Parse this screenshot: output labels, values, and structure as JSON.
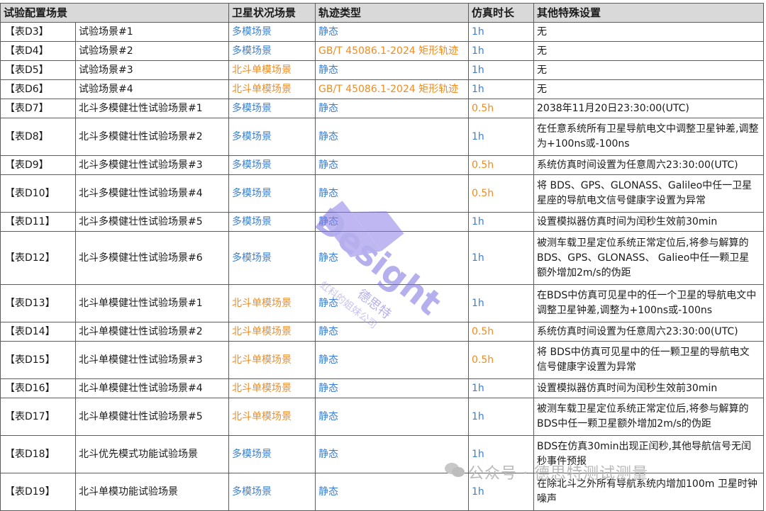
{
  "headers": {
    "scene": "试验配置场景",
    "satellite": "卫星状况场景",
    "trajectory": "轨迹类型",
    "duration": "仿真时长",
    "other": "其他特殊设置"
  },
  "rows": [
    {
      "id": "【表D3】",
      "name": "试验场景#1",
      "sat": "多模场景",
      "sat_color": "blue",
      "traj": "静态",
      "traj_color": "blue",
      "dur": "1h",
      "dur_color": "blue",
      "other": "无"
    },
    {
      "id": "【表D4】",
      "name": "试验场景#2",
      "sat": "多模场景",
      "sat_color": "blue",
      "traj": "GB/T 45086.1-2024 矩形轨迹",
      "traj_color": "orange",
      "dur": "1h",
      "dur_color": "blue",
      "other": "无"
    },
    {
      "id": "【表D5】",
      "name": "试验场景#3",
      "sat": "北斗单模场景",
      "sat_color": "orange",
      "traj": "静态",
      "traj_color": "blue",
      "dur": "1h",
      "dur_color": "blue",
      "other": "无"
    },
    {
      "id": "【表D6】",
      "name": "试验场景#4",
      "sat": "北斗单模场景",
      "sat_color": "orange",
      "traj": "GB/T 45086.1-2024 矩形轨迹",
      "traj_color": "orange",
      "dur": "1h",
      "dur_color": "blue",
      "other": "无"
    },
    {
      "id": "【表D7】",
      "name": "北斗多模健壮性试验场景#1",
      "sat": "多模场景",
      "sat_color": "blue",
      "traj": "静态",
      "traj_color": "blue",
      "dur": "0.5h",
      "dur_color": "orange",
      "other": "2038年11月20日23:30:00(UTC)"
    },
    {
      "id": "【表D8】",
      "name": "北斗多模健壮性试验场景#2",
      "sat": "多模场景",
      "sat_color": "blue",
      "traj": "静态",
      "traj_color": "blue",
      "dur": "1h",
      "dur_color": "blue",
      "other": "在任意系统所有卫星导航电文中调整卫星钟差,调整为+100ns或-100ns"
    },
    {
      "id": "【表D9】",
      "name": "北斗多模健壮性试验场景#3",
      "sat": "多模场景",
      "sat_color": "blue",
      "traj": "静态",
      "traj_color": "blue",
      "dur": "0.5h",
      "dur_color": "orange",
      "other": "系统仿真时间设置为任意周六23:30:00(UTC)"
    },
    {
      "id": "【表D10】",
      "name": "北斗多模健壮性试验场景#4",
      "sat": "多模场景",
      "sat_color": "blue",
      "traj": "静态",
      "traj_color": "blue",
      "dur": "0.5h",
      "dur_color": "orange",
      "other": "将 BDS、GPS、GLONASS、Galileo中任一卫星星座的导航电文信号健康字设置为异常"
    },
    {
      "id": "【表D11】",
      "name": "北斗多模健壮性试验场景#5",
      "sat": "多模场景",
      "sat_color": "blue",
      "traj": "静态",
      "traj_color": "blue",
      "dur": "1h",
      "dur_color": "blue",
      "other": "设置模拟器仿真时间为闰秒生效前30min"
    },
    {
      "id": "【表D12】",
      "name": "北斗多模健壮性试验场景#6",
      "sat": "多模场景",
      "sat_color": "blue",
      "traj": "静态",
      "traj_color": "blue",
      "dur": "1h",
      "dur_color": "blue",
      "other": "被测车载卫星定位系统正常定位后,将参与解算的 BDS、GPS、GLONASS、 Galieo中任一颗卫星额外增加2m/s的伪距"
    },
    {
      "id": "【表D13】",
      "name": "北斗单模健壮性试验场景#1",
      "sat": "北斗单模场景",
      "sat_color": "orange",
      "traj": "静态",
      "traj_color": "blue",
      "dur": "1h",
      "dur_color": "blue",
      "other": "在BDS中仿真可见星中的任一个卫星的导航电文中调整卫星钟差,调整为+100ns或-100ns"
    },
    {
      "id": "【表D14】",
      "name": "北斗单模健壮性试验场景#2",
      "sat": "北斗单模场景",
      "sat_color": "orange",
      "traj": "静态",
      "traj_color": "blue",
      "dur": "0.5h",
      "dur_color": "orange",
      "other": "系统仿真时间设置为任意周六23:30:00(UTC)"
    },
    {
      "id": "【表D15】",
      "name": "北斗单模健壮性试验场景#3",
      "sat": "北斗单模场景",
      "sat_color": "orange",
      "traj": "静态",
      "traj_color": "blue",
      "dur": "0.5h",
      "dur_color": "orange",
      "other": "将 BDS中仿真可见星中的任一颗卫星的导航电文信号健康字设置为异常"
    },
    {
      "id": "【表D16】",
      "name": "北斗单模健壮性试验场景#4",
      "sat": "北斗单模场景",
      "sat_color": "orange",
      "traj": "静态",
      "traj_color": "blue",
      "dur": "1h",
      "dur_color": "blue",
      "other": "设置模拟器仿真时间为闰秒生效前30min"
    },
    {
      "id": "【表D17】",
      "name": "北斗单模健壮性试验场景#5",
      "sat": "北斗单模场景",
      "sat_color": "orange",
      "traj": "静态",
      "traj_color": "blue",
      "dur": "1h",
      "dur_color": "blue",
      "other": "被测车载卫星定位系统正常定位后,将参与解算的BDS中任一颗卫星额外增加2m/s的伪距"
    },
    {
      "id": "【表D18】",
      "name": "北斗优先模式功能试验场景",
      "sat": "多模场景",
      "sat_color": "blue",
      "traj": "静态",
      "traj_color": "blue",
      "dur": "1h",
      "dur_color": "blue",
      "other": "BDS在仿真30min出现正闰秒,其他导航信号无闰秒事件预报"
    },
    {
      "id": "【表D19】",
      "name": "北斗单模功能试验场景",
      "sat": "多模场景",
      "sat_color": "blue",
      "traj": "静态",
      "traj_color": "blue",
      "dur": "1h",
      "dur_color": "blue",
      "other": "在除北斗之外所有导航系统内增加100m 卫星时钟噪声"
    }
  ],
  "watermark": {
    "logo_text": "Desight",
    "brand_cn": "德思特",
    "sub_cn": "虹科的姐妹公司",
    "footer": "公众号 · 德思特测试测量"
  },
  "colors": {
    "blue": "#3b7fd4",
    "orange": "#f08c24",
    "header_bg": "#d9d9d9"
  }
}
